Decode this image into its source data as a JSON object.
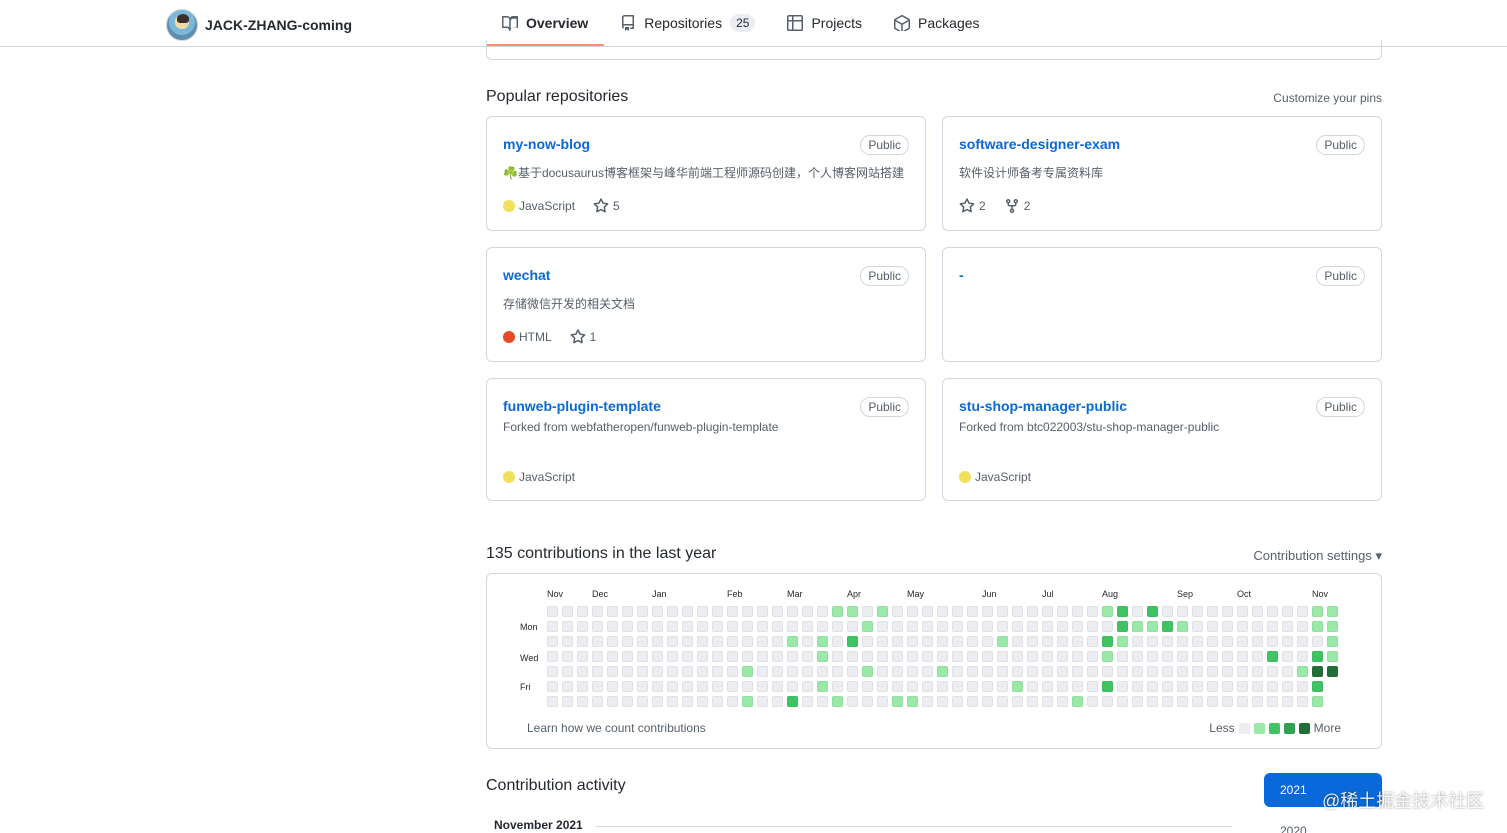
{
  "header": {
    "username": "JACK-ZHANG-coming",
    "tabs": [
      {
        "label": "Overview",
        "icon": "book-icon",
        "active": true
      },
      {
        "label": "Repositories",
        "icon": "repo-icon",
        "count": "25"
      },
      {
        "label": "Projects",
        "icon": "project-table-icon"
      },
      {
        "label": "Packages",
        "icon": "package-icon"
      }
    ]
  },
  "popular": {
    "title": "Popular repositories",
    "customize": "Customize your pins",
    "repos": [
      {
        "name": "my-now-blog",
        "badge": "Public",
        "desc": "☘️基于docusaurus博客框架与峰华前端工程师源码创建，个人博客网站搭建",
        "lang": "JavaScript",
        "lang_color": "#f1e05a",
        "stars": "5"
      },
      {
        "name": "software-designer-exam",
        "badge": "Public",
        "desc": "软件设计师备考专属资料库",
        "stars": "2",
        "forks": "2"
      },
      {
        "name": "wechat",
        "badge": "Public",
        "desc": "存储微信开发的相关文档",
        "lang": "HTML",
        "lang_color": "#e34c26",
        "stars": "1"
      },
      {
        "name": "-",
        "badge": "Public"
      },
      {
        "name": "funweb-plugin-template",
        "badge": "Public",
        "forked": "Forked from webfatheropen/funweb-plugin-template",
        "lang": "JavaScript",
        "lang_color": "#f1e05a"
      },
      {
        "name": "stu-shop-manager-public",
        "badge": "Public",
        "forked": "Forked from btc022003/stu-shop-manager-public",
        "lang": "JavaScript",
        "lang_color": "#f1e05a"
      }
    ]
  },
  "contributions": {
    "title": "135 contributions in the last year",
    "settings": "Contribution settings ▾",
    "months": [
      "Nov",
      "Dec",
      "Jan",
      "Feb",
      "Mar",
      "Apr",
      "May",
      "Jun",
      "Jul",
      "Aug",
      "Sep",
      "Oct",
      "Nov"
    ],
    "days": [
      "Mon",
      "Wed",
      "Fri"
    ],
    "learn": "Learn how we count contributions",
    "less": "Less",
    "more": "More",
    "colors": [
      "#ebedf0",
      "#9be9a8",
      "#40c463",
      "#30a14e",
      "#216e39"
    ]
  },
  "activity": {
    "title": "Contribution activity",
    "year_selected": "2021",
    "year_other": "2020",
    "month": "November 2021"
  },
  "watermark": "@稀土掘金技术社区"
}
